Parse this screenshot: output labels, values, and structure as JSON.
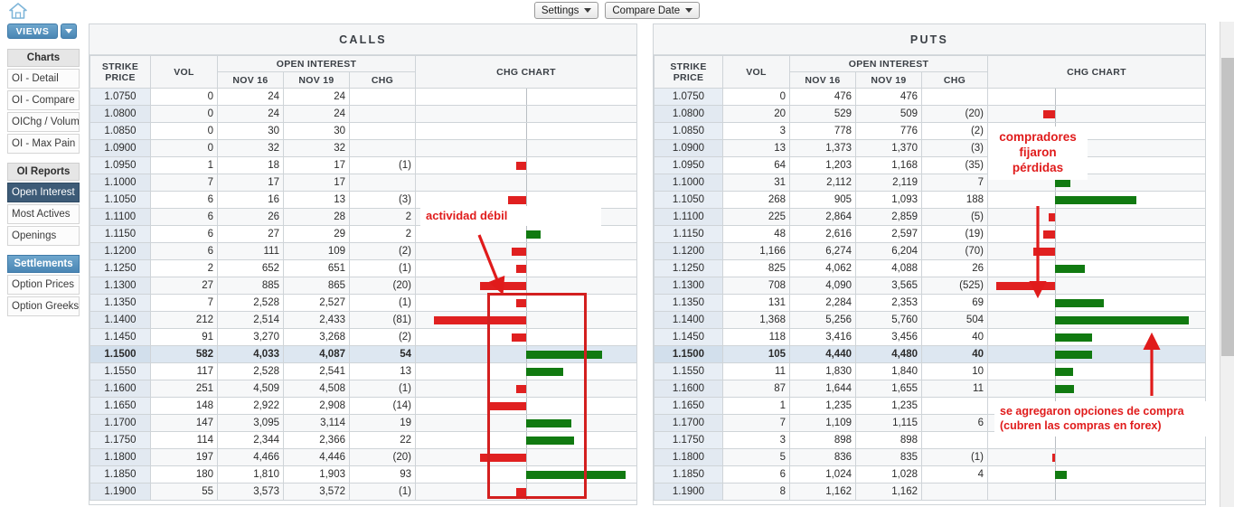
{
  "toolbar": {
    "settings_label": "Settings",
    "compare_date_label": "Compare Date"
  },
  "sidebar": {
    "home_icon": "home-icon",
    "views_label": "VIEWS",
    "groups": [
      {
        "header": "Charts",
        "style": "gray",
        "items": [
          {
            "label": "OI - Detail",
            "active": false
          },
          {
            "label": "OI - Compare",
            "active": false
          },
          {
            "label": "OIChg / Volume",
            "active": false
          },
          {
            "label": "OI - Max Pain",
            "active": false
          }
        ]
      },
      {
        "header": "OI Reports",
        "style": "gray",
        "items": [
          {
            "label": "Open Interest",
            "active": true
          },
          {
            "label": "Most Actives",
            "active": false
          },
          {
            "label": "Openings",
            "active": false
          }
        ]
      },
      {
        "header": "Settlements",
        "style": "blue",
        "items": [
          {
            "label": "Option Prices",
            "active": false
          },
          {
            "label": "Option Greeks",
            "active": false
          }
        ]
      }
    ]
  },
  "columns": {
    "strike": "STRIKE PRICE",
    "vol": "VOL",
    "open_interest": "OPEN INTEREST",
    "date1": "NOV 16",
    "date2": "NOV 19",
    "chg": "CHG",
    "chg_chart": "CHG CHART"
  },
  "calls": {
    "title": "CALLS",
    "rows": [
      {
        "strike": "1.0750",
        "vol": "0",
        "oi1": "24",
        "oi2": "24",
        "chg": "",
        "chg_val": 0
      },
      {
        "strike": "1.0800",
        "vol": "0",
        "oi1": "24",
        "oi2": "24",
        "chg": "",
        "chg_val": 0
      },
      {
        "strike": "1.0850",
        "vol": "0",
        "oi1": "30",
        "oi2": "30",
        "chg": "",
        "chg_val": 0
      },
      {
        "strike": "1.0900",
        "vol": "0",
        "oi1": "32",
        "oi2": "32",
        "chg": "",
        "chg_val": 0
      },
      {
        "strike": "1.0950",
        "vol": "1",
        "oi1": "18",
        "oi2": "17",
        "chg": "(1)",
        "chg_val": -1
      },
      {
        "strike": "1.1000",
        "vol": "7",
        "oi1": "17",
        "oi2": "17",
        "chg": "",
        "chg_val": 0
      },
      {
        "strike": "1.1050",
        "vol": "6",
        "oi1": "16",
        "oi2": "13",
        "chg": "(3)",
        "chg_val": -3
      },
      {
        "strike": "1.1100",
        "vol": "6",
        "oi1": "26",
        "oi2": "28",
        "chg": "2",
        "chg_val": 2
      },
      {
        "strike": "1.1150",
        "vol": "6",
        "oi1": "27",
        "oi2": "29",
        "chg": "2",
        "chg_val": 2
      },
      {
        "strike": "1.1200",
        "vol": "6",
        "oi1": "111",
        "oi2": "109",
        "chg": "(2)",
        "chg_val": -2
      },
      {
        "strike": "1.1250",
        "vol": "2",
        "oi1": "652",
        "oi2": "651",
        "chg": "(1)",
        "chg_val": -1
      },
      {
        "strike": "1.1300",
        "vol": "27",
        "oi1": "885",
        "oi2": "865",
        "chg": "(20)",
        "chg_val": -20
      },
      {
        "strike": "1.1350",
        "vol": "7",
        "oi1": "2,528",
        "oi2": "2,527",
        "chg": "(1)",
        "chg_val": -1
      },
      {
        "strike": "1.1400",
        "vol": "212",
        "oi1": "2,514",
        "oi2": "2,433",
        "chg": "(81)",
        "chg_val": -81
      },
      {
        "strike": "1.1450",
        "vol": "91",
        "oi1": "3,270",
        "oi2": "3,268",
        "chg": "(2)",
        "chg_val": -2
      },
      {
        "strike": "1.1500",
        "vol": "582",
        "oi1": "4,033",
        "oi2": "4,087",
        "chg": "54",
        "chg_val": 54,
        "atm": true
      },
      {
        "strike": "1.1550",
        "vol": "117",
        "oi1": "2,528",
        "oi2": "2,541",
        "chg": "13",
        "chg_val": 13
      },
      {
        "strike": "1.1600",
        "vol": "251",
        "oi1": "4,509",
        "oi2": "4,508",
        "chg": "(1)",
        "chg_val": -1
      },
      {
        "strike": "1.1650",
        "vol": "148",
        "oi1": "2,922",
        "oi2": "2,908",
        "chg": "(14)",
        "chg_val": -14
      },
      {
        "strike": "1.1700",
        "vol": "147",
        "oi1": "3,095",
        "oi2": "3,114",
        "chg": "19",
        "chg_val": 19
      },
      {
        "strike": "1.1750",
        "vol": "114",
        "oi1": "2,344",
        "oi2": "2,366",
        "chg": "22",
        "chg_val": 22
      },
      {
        "strike": "1.1800",
        "vol": "197",
        "oi1": "4,466",
        "oi2": "4,446",
        "chg": "(20)",
        "chg_val": -20
      },
      {
        "strike": "1.1850",
        "vol": "180",
        "oi1": "1,810",
        "oi2": "1,903",
        "chg": "93",
        "chg_val": 93
      },
      {
        "strike": "1.1900",
        "vol": "55",
        "oi1": "3,573",
        "oi2": "3,572",
        "chg": "(1)",
        "chg_val": -1
      }
    ]
  },
  "puts": {
    "title": "PUTS",
    "rows": [
      {
        "strike": "1.0750",
        "vol": "0",
        "oi1": "476",
        "oi2": "476",
        "chg": "",
        "chg_val": 0
      },
      {
        "strike": "1.0800",
        "vol": "20",
        "oi1": "529",
        "oi2": "509",
        "chg": "(20)",
        "chg_val": -20
      },
      {
        "strike": "1.0850",
        "vol": "3",
        "oi1": "778",
        "oi2": "776",
        "chg": "(2)",
        "chg_val": -2
      },
      {
        "strike": "1.0900",
        "vol": "13",
        "oi1": "1,373",
        "oi2": "1,370",
        "chg": "(3)",
        "chg_val": -3
      },
      {
        "strike": "1.0950",
        "vol": "64",
        "oi1": "1,203",
        "oi2": "1,168",
        "chg": "(35)",
        "chg_val": -35
      },
      {
        "strike": "1.1000",
        "vol": "31",
        "oi1": "2,112",
        "oi2": "2,119",
        "chg": "7",
        "chg_val": 7
      },
      {
        "strike": "1.1050",
        "vol": "268",
        "oi1": "905",
        "oi2": "1,093",
        "chg": "188",
        "chg_val": 188
      },
      {
        "strike": "1.1100",
        "vol": "225",
        "oi1": "2,864",
        "oi2": "2,859",
        "chg": "(5)",
        "chg_val": -5
      },
      {
        "strike": "1.1150",
        "vol": "48",
        "oi1": "2,616",
        "oi2": "2,597",
        "chg": "(19)",
        "chg_val": -19
      },
      {
        "strike": "1.1200",
        "vol": "1,166",
        "oi1": "6,274",
        "oi2": "6,204",
        "chg": "(70)",
        "chg_val": -70
      },
      {
        "strike": "1.1250",
        "vol": "825",
        "oi1": "4,062",
        "oi2": "4,088",
        "chg": "26",
        "chg_val": 26
      },
      {
        "strike": "1.1300",
        "vol": "708",
        "oi1": "4,090",
        "oi2": "3,565",
        "chg": "(525)",
        "chg_val": -525
      },
      {
        "strike": "1.1350",
        "vol": "131",
        "oi1": "2,284",
        "oi2": "2,353",
        "chg": "69",
        "chg_val": 69
      },
      {
        "strike": "1.1400",
        "vol": "1,368",
        "oi1": "5,256",
        "oi2": "5,760",
        "chg": "504",
        "chg_val": 504
      },
      {
        "strike": "1.1450",
        "vol": "118",
        "oi1": "3,416",
        "oi2": "3,456",
        "chg": "40",
        "chg_val": 40
      },
      {
        "strike": "1.1500",
        "vol": "105",
        "oi1": "4,440",
        "oi2": "4,480",
        "chg": "40",
        "chg_val": 40,
        "atm": true
      },
      {
        "strike": "1.1550",
        "vol": "11",
        "oi1": "1,830",
        "oi2": "1,840",
        "chg": "10",
        "chg_val": 10
      },
      {
        "strike": "1.1600",
        "vol": "87",
        "oi1": "1,644",
        "oi2": "1,655",
        "chg": "11",
        "chg_val": 11
      },
      {
        "strike": "1.1650",
        "vol": "1",
        "oi1": "1,235",
        "oi2": "1,235",
        "chg": "",
        "chg_val": 0
      },
      {
        "strike": "1.1700",
        "vol": "7",
        "oi1": "1,109",
        "oi2": "1,115",
        "chg": "6",
        "chg_val": 6
      },
      {
        "strike": "1.1750",
        "vol": "3",
        "oi1": "898",
        "oi2": "898",
        "chg": "",
        "chg_val": 0
      },
      {
        "strike": "1.1800",
        "vol": "5",
        "oi1": "836",
        "oi2": "835",
        "chg": "(1)",
        "chg_val": -1
      },
      {
        "strike": "1.1850",
        "vol": "6",
        "oi1": "1,024",
        "oi2": "1,028",
        "chg": "4",
        "chg_val": 4
      },
      {
        "strike": "1.1900",
        "vol": "8",
        "oi1": "1,162",
        "oi2": "1,162",
        "chg": "",
        "chg_val": 0
      }
    ]
  },
  "annotations": {
    "weak_activity": "actividad débil",
    "buyers_locked": "compradores\nfijaron\npérdidas",
    "calls_added": "se agregaron opciones de compra\n(cubren las compras en forex)"
  },
  "colors": {
    "positive": "#117a11",
    "negative": "#e02020",
    "annotation": "#e01b1b",
    "accent": "#4a86b4",
    "active_nav": "#3d5b77"
  }
}
